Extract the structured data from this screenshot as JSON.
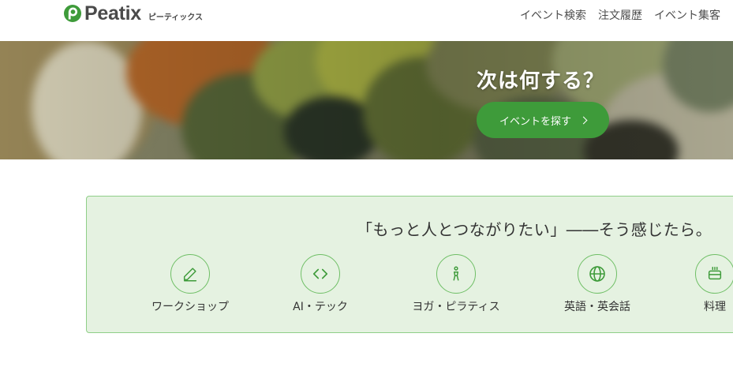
{
  "header": {
    "logo_text": "Peatix",
    "logo_kana": "ピーティックス",
    "nav": [
      {
        "label": "イベント検索"
      },
      {
        "label": "注文履歴"
      },
      {
        "label": "イベント集客"
      }
    ]
  },
  "hero": {
    "title": "次は何する？",
    "button_label": "イベントを探す"
  },
  "categories_panel": {
    "tagline": "「もっと人とつながりたい」――そう感じたら。",
    "items": [
      {
        "label": "ワークショップ",
        "icon": "pencil-icon"
      },
      {
        "label": "AI・テック",
        "icon": "code-icon"
      },
      {
        "label": "ヨガ・ピラティス",
        "icon": "yoga-icon"
      },
      {
        "label": "英語・英会話",
        "icon": "globe-icon"
      },
      {
        "label": "料理",
        "icon": "cooking-pot-icon"
      }
    ]
  },
  "colors": {
    "brand_green": "#3e9b3a",
    "panel_bg": "#e5f2e1",
    "panel_border": "#8fcf88"
  }
}
